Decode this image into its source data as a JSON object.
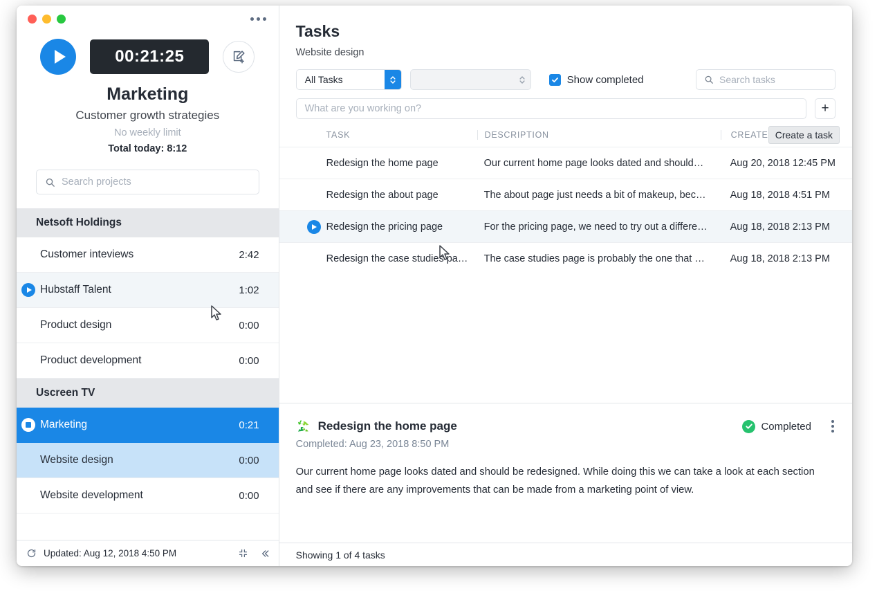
{
  "window": {
    "traffic_lights": [
      "close",
      "minimize",
      "zoom"
    ],
    "overflow_menu": "more-options"
  },
  "sidebar": {
    "timer": {
      "play_label": "Start timer",
      "elapsed": "00:21:25",
      "edit_label": "Add note"
    },
    "project": {
      "name": "Marketing",
      "task": "Customer growth strategies",
      "weekly_limit": "No weekly limit",
      "total_today": "Total today: 8:12"
    },
    "search": {
      "placeholder": "Search projects",
      "value": ""
    },
    "groups": [
      {
        "name": "Netsoft Holdings",
        "items": [
          {
            "label": "Customer inteviews",
            "time": "2:42",
            "icon": "",
            "state": ""
          },
          {
            "label": "Hubstaff Talent",
            "time": "1:02",
            "icon": "play",
            "state": "hover"
          },
          {
            "label": "Product design",
            "time": "0:00",
            "icon": "",
            "state": ""
          },
          {
            "label": "Product development",
            "time": "0:00",
            "icon": "",
            "state": ""
          }
        ]
      },
      {
        "name": "Uscreen TV",
        "items": [
          {
            "label": "Marketing",
            "time": "0:21",
            "icon": "stop",
            "state": "active"
          },
          {
            "label": "Website design",
            "time": "0:00",
            "icon": "",
            "state": "selected"
          },
          {
            "label": "Website development",
            "time": "0:00",
            "icon": "",
            "state": ""
          }
        ]
      }
    ],
    "footer": {
      "updated": "Updated: Aug 12, 2018 4:50 PM",
      "refresh_icon": "refresh-icon",
      "compact_icon": "compact-view-icon",
      "collapse_icon": "collapse-sidebar-icon"
    }
  },
  "main": {
    "title": "Tasks",
    "subtitle": "Website design",
    "filters": {
      "task_filter_value": "All Tasks",
      "task_filter_options": [
        "All Tasks"
      ],
      "secondary_filter_value": "",
      "show_completed_label": "Show completed",
      "show_completed_checked": true
    },
    "search": {
      "placeholder": "Search tasks",
      "value": ""
    },
    "new_task": {
      "placeholder": "What are you working on?",
      "value": "",
      "add_button": "+",
      "tooltip": "Create a task"
    },
    "table": {
      "columns": [
        "TASK",
        "DESCRIPTION",
        "CREATED"
      ],
      "rows": [
        {
          "task": "Redesign the home page",
          "description": "Our current home page looks dated and should…",
          "created": "Aug 20, 2018 12:45 PM",
          "icon": "",
          "state": ""
        },
        {
          "task": "Redesign the about page",
          "description": "The about page just needs a bit of makeup, bec…",
          "created": "Aug 18, 2018 4:51 PM",
          "icon": "",
          "state": ""
        },
        {
          "task": "Redesign the pricing page",
          "description": "For the pricing page, we need to try out a differe…",
          "created": "Aug 18, 2018 2:13 PM",
          "icon": "play",
          "state": "hover"
        },
        {
          "task": "Redesign the case studies pa…",
          "description": "The case studies page is probably the one that …",
          "created": "Aug 18, 2018 2:13 PM",
          "icon": "",
          "state": ""
        }
      ]
    },
    "detail": {
      "source_icon": "integration-logo-icon",
      "title": "Redesign the home page",
      "meta": "Completed: Aug 23, 2018 8:50 PM",
      "status": "Completed",
      "body": "Our current home page looks dated and should be redesigned. While doing this we can take a look at each section and see if there are any improvements that can be made from a marketing point of view.",
      "menu_icon": "kebab-menu-icon"
    },
    "footer": {
      "showing": "Showing 1 of 4 tasks"
    }
  },
  "colors": {
    "accent_blue": "#1a87e6",
    "selected_blue": "#c7e2f9",
    "timer_dark": "#24292f",
    "success_green": "#26c26e",
    "group_header_grey": "#e5e7ea"
  }
}
